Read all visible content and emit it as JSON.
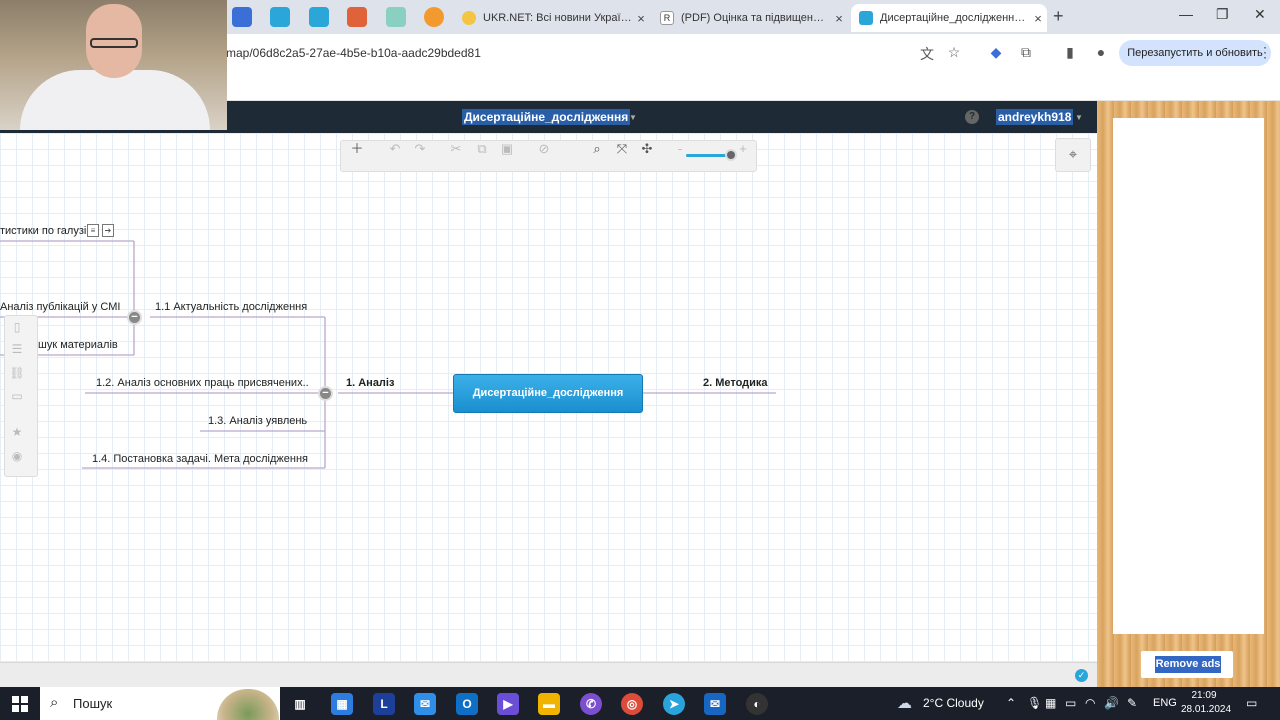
{
  "browser": {
    "tabs": [
      {
        "title": "UKR.NET: Всі новини України, ост",
        "favicon_color": "#f4c542"
      },
      {
        "title": "(PDF) Оцінка та підвищення на",
        "favicon_color": "#ffffff"
      },
      {
        "title": "Дисертаційне_дослідження - Mi",
        "favicon_color": "#2aa7d8"
      }
    ],
    "pinned_tab_colors": [
      "#3a6fd8",
      "#2aa7d8",
      "#2aa7d8",
      "#e0623a",
      "#8ad0c0",
      "#f29a2e"
    ],
    "url": "map/06d8c2a5-27ae-4b5e-b10a-aadc29bded81",
    "relaunch_label": "Перезапустить и обновить",
    "new_tab_label": "+",
    "close_glyph": "×"
  },
  "app": {
    "map_title": "Дисертаційне_дослідження",
    "user": "andreykh918",
    "help_glyph": "?"
  },
  "mindmap": {
    "central": "Дисертаційне_дослідження",
    "branches": {
      "analysis": "1. Аналіз",
      "method": "2. Методика"
    },
    "subtopics": {
      "relevance": "1.1 Актуальність дослідження",
      "works": "1.2. Аналіз основних праць присвячених..",
      "concepts": "1.3. Аналіз уявлень",
      "task": "1.4. Постановка задачі. Мета дослідження"
    },
    "leaves": {
      "stats": "тистики по галузі",
      "media": "Аналіз публікацій у СМІ",
      "materials": "шук материалів"
    },
    "collapse_glyph": "−"
  },
  "ads": {
    "remove_label": "Remove ads"
  },
  "taskbar": {
    "search_placeholder": "Пошук",
    "weather": "2°C  Cloudy",
    "language": "ENG",
    "time": "21:09",
    "date": "28.01.2024"
  }
}
